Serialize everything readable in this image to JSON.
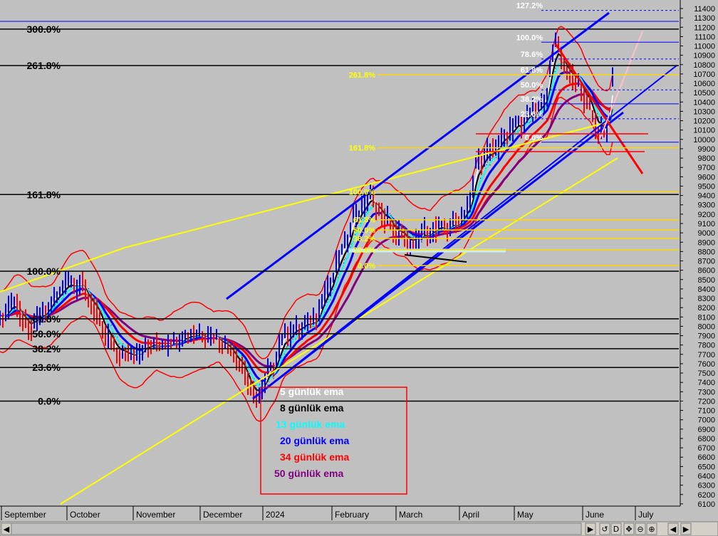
{
  "chart_data": {
    "type": "candlestick",
    "y_axis_ticks": [
      6100,
      6200,
      6300,
      6400,
      6500,
      6600,
      6700,
      6800,
      6900,
      7000,
      7100,
      7200,
      7300,
      7400,
      7500,
      7600,
      7700,
      7800,
      7900,
      8000,
      8100,
      8200,
      8300,
      8400,
      8500,
      8600,
      8700,
      8800,
      8900,
      9000,
      9100,
      9200,
      9300,
      9400,
      9500,
      9600,
      9700,
      9800,
      9900,
      10000,
      10100,
      10200,
      10300,
      10400,
      10500,
      10600,
      10700,
      10800,
      10900,
      11000,
      11100,
      11200,
      11300,
      11400
    ],
    "x_axis_ticks": [
      "September",
      "October",
      "November",
      "December",
      "2024",
      "February",
      "March",
      "April",
      "May",
      "June",
      "July"
    ],
    "fib_main": [
      {
        "label": "300.0%",
        "value": 11180
      },
      {
        "label": "261.8%",
        "value": 10790
      },
      {
        "label": "161.8%",
        "value": 9410
      },
      {
        "label": "100.0%",
        "value": 8590
      },
      {
        "label": "61.8%",
        "value": 8080
      },
      {
        "label": "50.0%",
        "value": 7920
      },
      {
        "label": "38.2%",
        "value": 7760
      },
      {
        "label": "23.6%",
        "value": 7560
      },
      {
        "label": "0.0%",
        "value": 7200
      }
    ],
    "fib_inner": [
      {
        "label": "127.2%",
        "value": 11380
      },
      {
        "label": "100.0%",
        "value": 11040
      },
      {
        "label": "78.6%",
        "value": 10860
      },
      {
        "label": "61.8%",
        "value": 10690
      },
      {
        "label": "50.0%",
        "value": 10530
      },
      {
        "label": "38.2%",
        "value": 10380
      },
      {
        "label": "23.6%",
        "value": 10220
      },
      {
        "label": "0.0%",
        "value": 9970
      }
    ],
    "fib_yellow": [
      {
        "label": "261.8%",
        "value": 10690
      },
      {
        "label": "161.8%",
        "value": 9910
      },
      {
        "label": "100.0%",
        "value": 9440
      },
      {
        "label": "61.8%",
        "value": 9140
      },
      {
        "label": "50.0%",
        "value": 9030
      },
      {
        "label": "38.2%",
        "value": 8940
      },
      {
        "label": "23.6%",
        "value": 8820
      },
      {
        "label": "0.0%",
        "value": 8650
      }
    ],
    "legend": [
      {
        "label": "5 günlük ema",
        "color": "#ffffff"
      },
      {
        "label": "8 günlük ema",
        "color": "#000000"
      },
      {
        "label": "13 günlük ema",
        "color": "#00ffff"
      },
      {
        "label": "20 günlük ema",
        "color": "#0000ff"
      },
      {
        "label": "34 günlük ema",
        "color": "#ff0000"
      },
      {
        "label": "50 günlük ema",
        "color": "#800080"
      }
    ],
    "colors": {
      "background": "#c0c0c0",
      "bars": "#0000ff",
      "bollinger": "#ff0000",
      "fib_yellow": "#ffd700",
      "channel": "#0000ff",
      "trend_yellow": "#ffff00",
      "down_trend": "#ff0000",
      "up_trend": "#ffc0cb"
    }
  },
  "scrollbar": {
    "buttons": [
      "◀",
      "▶",
      "↺",
      "D",
      "✥",
      "⊖",
      "⊕",
      "◀",
      "▶"
    ]
  }
}
